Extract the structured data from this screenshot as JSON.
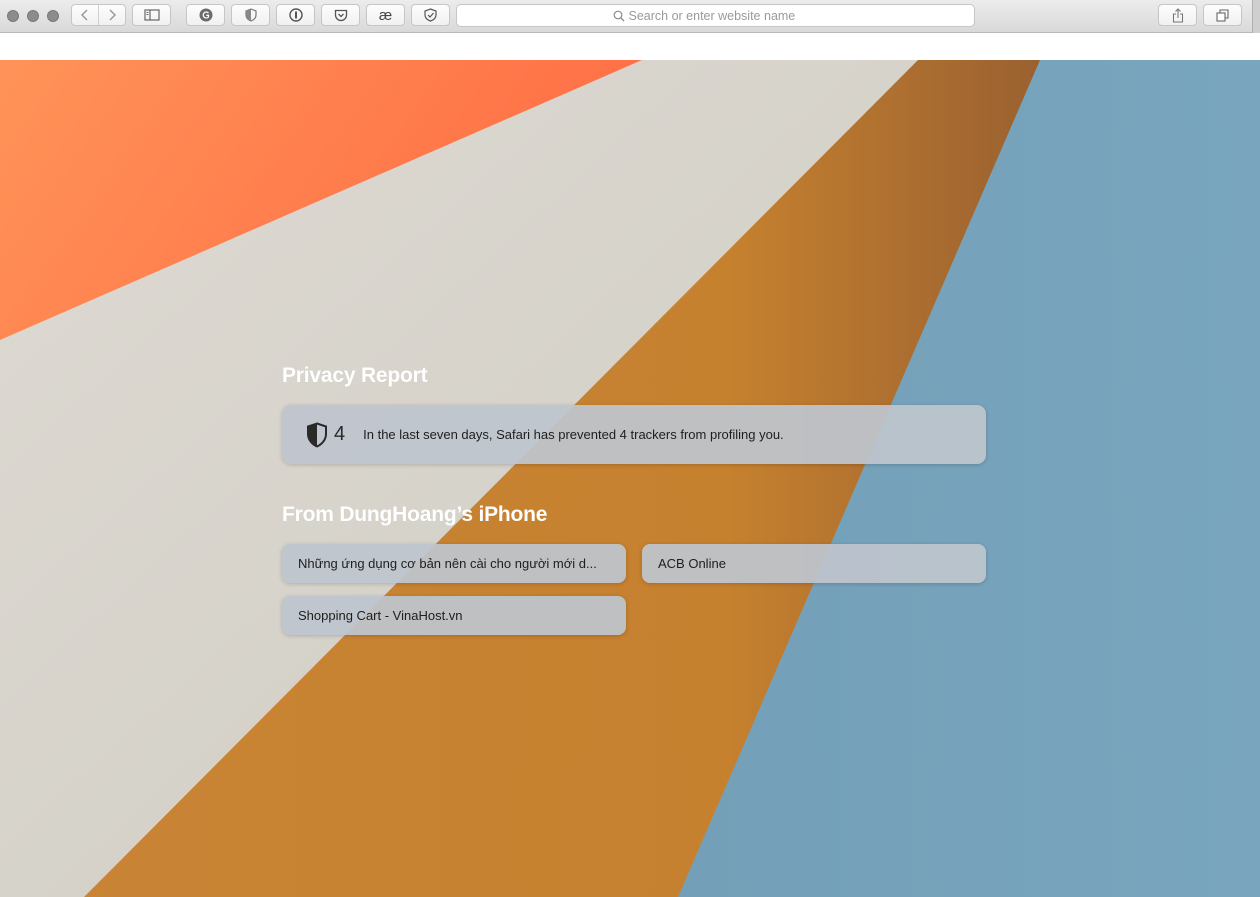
{
  "toolbar": {
    "traffic_lights": [
      "close",
      "minimize",
      "zoom"
    ],
    "back_icon": "chevron-left-icon",
    "forward_icon": "chevron-right-icon",
    "sidebar_icon": "sidebar-icon",
    "extensions": [
      "grammarly-icon",
      "ublock-shield-icon",
      "onepassword-icon",
      "pocket-icon",
      "ae-extension-icon",
      "adguard-shield-icon"
    ],
    "ae_label": "æ",
    "address_placeholder": "Search or enter website name",
    "share_icon": "share-icon",
    "tabs_icon": "tab-overview-icon"
  },
  "privacy_report": {
    "title": "Privacy Report",
    "tracker_count": "4",
    "message": "In the last seven days, Safari has prevented 4 trackers from profiling you.",
    "icon": "shield-icon"
  },
  "icloud_tabs": {
    "title": "From DungHoang’s iPhone",
    "items": [
      {
        "label": "Những ứng dụng cơ bản nên cài cho người mới d..."
      },
      {
        "label": "ACB Online"
      },
      {
        "label": "Shopping Cart - VinaHost.vn"
      }
    ]
  },
  "colors": {
    "orange": "#ff7f4f",
    "cream": "#d9d6cf",
    "amber": "#c4822f",
    "blue": "#78a5bd",
    "card": "#bec5ce"
  }
}
